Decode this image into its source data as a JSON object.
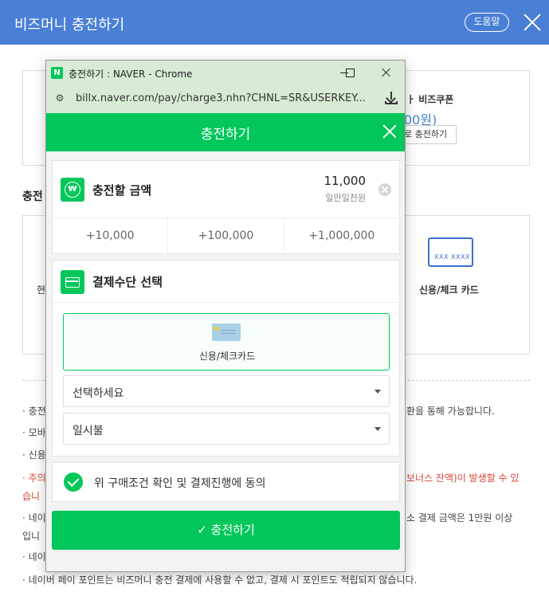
{
  "page": {
    "title": "비즈머니 충전하기",
    "help_label": "도움말",
    "coupon_label": "ㅏ 비즈쿠폰",
    "coupon_amount": "00원)",
    "coupon_button": "로 충전하기",
    "section_label": "충전",
    "left_method_label": "현",
    "card_method_label": "신용/체크 카드",
    "card_icon_text": "XXX XXXX",
    "notes": [
      {
        "text": "· 충전",
        "tail": "환을 통해 가능합니다.",
        "red": false
      },
      {
        "text": "· 모바",
        "tail": "",
        "red": false
      },
      {
        "text": "· 신용",
        "tail": "",
        "red": false
      },
      {
        "text": "· 주의",
        "tail": "보너스 잔액)이 발생할 수 있",
        "red": true
      },
      {
        "text": "  습니",
        "tail": "",
        "red": true
      },
      {
        "text": "· 네이",
        "tail": "소 결제 금액은 1만원 이상",
        "red": false
      },
      {
        "text": "  입니",
        "tail": "",
        "red": false
      },
      {
        "text": "· 네이",
        "tail": "",
        "red": false
      },
      {
        "text": "· 네이버 페이 포인트는 비즈머니 충전 결제에 사용할 수 없고, 결제 시 포인트도 적립되지 않습니다.",
        "tail": "",
        "red": false
      }
    ]
  },
  "popup": {
    "window_title": "충전하기 : NAVER - Chrome",
    "logo": "N",
    "url": "billx.naver.com/pay/charge3.nhn?CHNL=SR&USERKEY...",
    "header_title": "충전하기",
    "amount": {
      "title": "충전할 금액",
      "value": "11,000",
      "korean": "일만일천원",
      "increments": [
        "+10,000",
        "+100,000",
        "+1,000,000"
      ]
    },
    "payment": {
      "title": "결제수단 선택",
      "card_label": "신용/체크카드",
      "select_placeholder": "선택하세요",
      "installment": "일시불"
    },
    "agree_text": "위 구매조건 확인 및 결제진행에 동의",
    "charge_button": "✓ 충전하기"
  },
  "colors": {
    "naver_green": "#03c75a",
    "topbar_blue": "#4a7fd6",
    "note_red": "#d9453a"
  }
}
